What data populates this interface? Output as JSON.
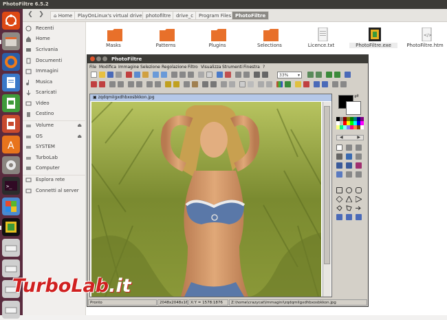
{
  "topbar": {
    "title": "PhotoFiltre 6.5.2"
  },
  "navbar": {
    "crumbs": [
      "Home",
      "PlayOnLinux's virtual drives",
      "photofiltre",
      "drive_c",
      "Program Files",
      "PhotoFiltre"
    ]
  },
  "sidebar": {
    "items": [
      {
        "label": "Recenti",
        "icon": "clock-icon"
      },
      {
        "label": "Home",
        "icon": "home-icon"
      },
      {
        "label": "Scrivania",
        "icon": "desktop-icon"
      },
      {
        "label": "Documenti",
        "icon": "documents-icon"
      },
      {
        "label": "Immagini",
        "icon": "pictures-icon"
      },
      {
        "label": "Musica",
        "icon": "music-icon"
      },
      {
        "label": "Scaricati",
        "icon": "download-icon"
      },
      {
        "label": "Video",
        "icon": "video-icon"
      },
      {
        "label": "Cestino",
        "icon": "trash-icon"
      },
      {
        "label": "Volume",
        "icon": "drive-icon",
        "eject": true
      },
      {
        "label": "OS",
        "icon": "drive-icon",
        "eject": true
      },
      {
        "label": "SYSTEM",
        "icon": "drive-icon"
      },
      {
        "label": "TurboLab",
        "icon": "drive-icon"
      },
      {
        "label": "Computer",
        "icon": "computer-icon"
      },
      {
        "label": "Esplora rete",
        "icon": "network-icon"
      },
      {
        "label": "Connetti al server",
        "icon": "server-icon"
      }
    ]
  },
  "files": [
    {
      "label": "Masks",
      "icon": "folder-icon"
    },
    {
      "label": "Patterns",
      "icon": "folder-icon"
    },
    {
      "label": "Plugins",
      "icon": "folder-icon"
    },
    {
      "label": "Selections",
      "icon": "folder-icon"
    },
    {
      "label": "Licence.txt",
      "icon": "text-file-icon"
    },
    {
      "label": "PhotoFiltre.exe",
      "icon": "exe-icon"
    },
    {
      "label": "PhotoFiltre.htm",
      "icon": "html-file-icon"
    }
  ],
  "pf": {
    "title": "PhotoFiltre",
    "menu": [
      "File",
      "Modifica",
      "Immagine",
      "Selezione",
      "Regolazione",
      "Filtro",
      "Visualizza",
      "Strumenti",
      "Finestra",
      "?"
    ],
    "zoom": "33%",
    "image_title": "zqdqmiIgxdhbxosbkkon.jpg",
    "status": {
      "state": "Pronto",
      "size": "2048x2048x16M",
      "coords": "X:Y = 1578:1876",
      "path": "Z:\\home\\crazycat\\Immagini\\zqdqmiIgxdhbxosbkkon.jpg"
    }
  },
  "watermark": {
    "text1": "TurboLab",
    "text2": ".it"
  },
  "colors": {
    "ubuntu_orange": "#dd4814",
    "launcher": "#5a2b3e",
    "folder": "#e8702a",
    "selection": "#8c8a85"
  }
}
